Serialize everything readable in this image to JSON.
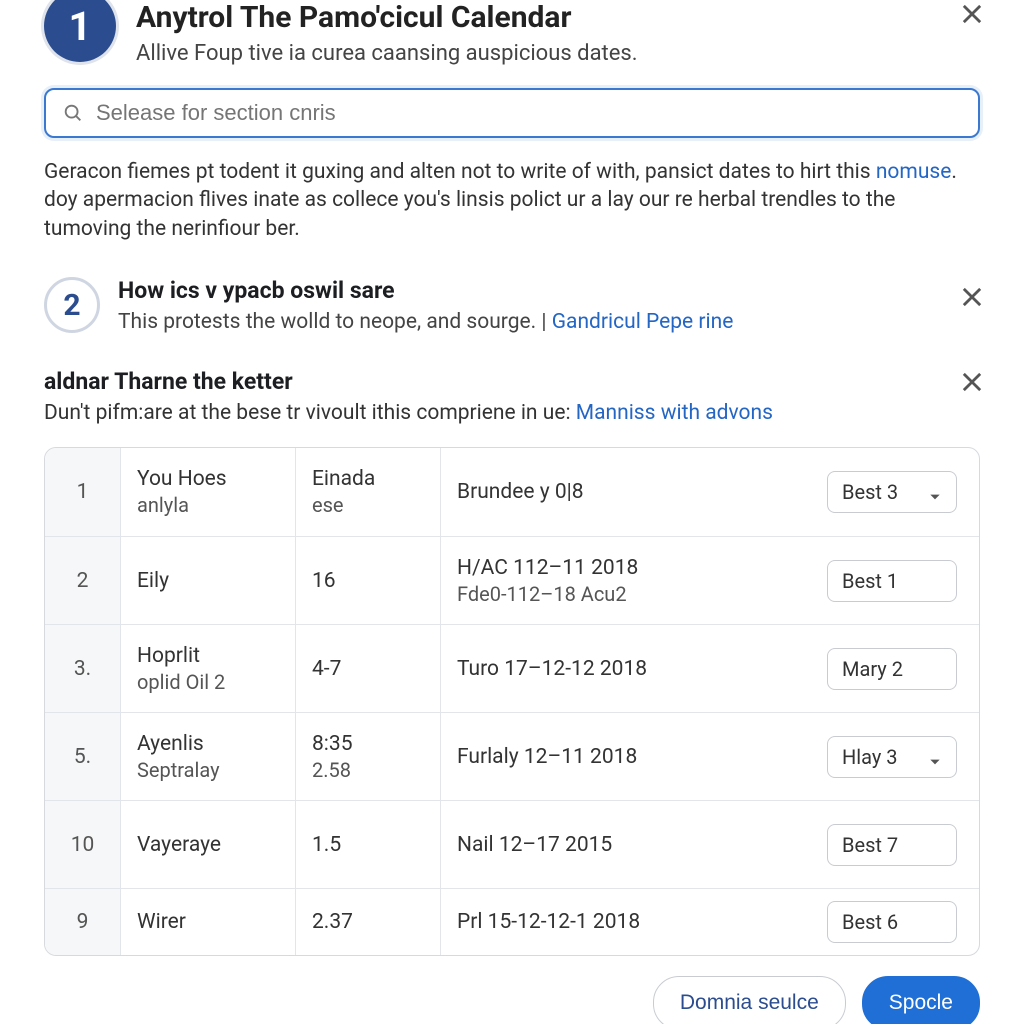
{
  "header": {
    "step_num": "1",
    "title": "Anytrol The Pamo'cicul Calendar",
    "subtitle": "Allive Foup tive ia curea caansing auspicious dates."
  },
  "search": {
    "placeholder": "Selease for section cnris"
  },
  "intro": {
    "text": "Geracon fiemes pt todent it guxing and alten not to write of with, pansict dates to hirt this ",
    "link": "nomuse",
    "text2": ". doy apermacion flives inate as collece you's linsis polict ur a lay our re herbal trendles to the tumoving the nerinfiour ber."
  },
  "step2": {
    "num": "2",
    "title": "How ics v ypacb oswil sare",
    "sub_text": "This protests the wolld to neope, and sourge.  | ",
    "sub_link": "Gandricul Pepe rine"
  },
  "section3": {
    "title": "aldnar Tharne the ketter",
    "sub_text": "Dun't pifm:are at the bese tr vivoult ithis compriene in ue:  ",
    "sub_link": "Manniss with advons"
  },
  "table": {
    "rows": [
      {
        "idx": "1",
        "a1": "You Hoes",
        "a2": "anlyla",
        "b1": "Einada",
        "b2": "ese",
        "c1": "Brundee y 0|8",
        "c2": "",
        "d": "Best 3",
        "chev": true
      },
      {
        "idx": "2",
        "a1": "Eily",
        "a2": "",
        "b1": "16",
        "b2": "",
        "c1": "H/AC 112–11 2018",
        "c2": "Fde0-112–18 Acu2",
        "d": "Best 1",
        "chev": false
      },
      {
        "idx": "3.",
        "a1": "Hoprlit",
        "a2": "oplid Oil 2",
        "b1": "4-7",
        "b2": "",
        "c1": "Turo 17–12-12 2018",
        "c2": "",
        "d": "Mary 2",
        "chev": false
      },
      {
        "idx": "5.",
        "a1": "Ayenlis",
        "a2": "Septralay",
        "b1": "8:35",
        "b2": "2.58",
        "c1": "Furlaly 12–11 2018",
        "c2": "",
        "d": "Hlay 3",
        "chev": true
      },
      {
        "idx": "10",
        "a1": "Vayeraye",
        "a2": "",
        "b1": "1.5",
        "b2": "",
        "c1": "Nail 12–17 2015",
        "c2": "",
        "d": "Best 7",
        "chev": false
      },
      {
        "idx": "9",
        "a1": "Wirer",
        "a2": "",
        "b1": "2.37",
        "b2": "",
        "c1": "Prl 15-12-12-1 2018",
        "c2": "",
        "d": "Best 6",
        "chev": false
      }
    ]
  },
  "footer": {
    "secondary": "Domnia seulce",
    "primary": "Spocle"
  }
}
